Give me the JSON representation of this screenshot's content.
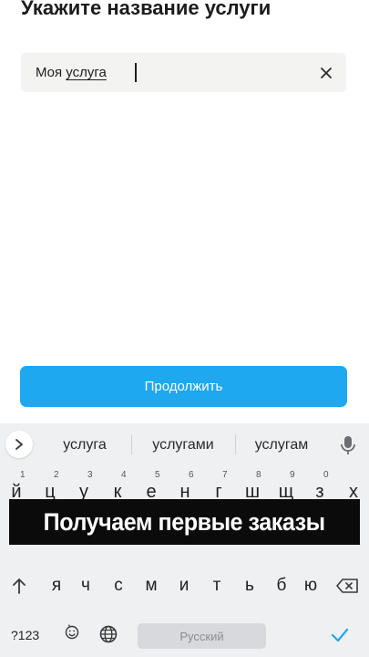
{
  "header": {
    "title": "Укажите название услуги"
  },
  "service_field": {
    "value_prefix": "Моя ",
    "value_word": "услуга"
  },
  "continue_button": {
    "label": "Продолжить"
  },
  "keyboard": {
    "suggestions": [
      "услуга",
      "услугами",
      "услугам"
    ],
    "row1": [
      {
        "key": "й",
        "hint": "1"
      },
      {
        "key": "ц",
        "hint": "2"
      },
      {
        "key": "у",
        "hint": "3"
      },
      {
        "key": "к",
        "hint": "4"
      },
      {
        "key": "е",
        "hint": "5"
      },
      {
        "key": "н",
        "hint": "6"
      },
      {
        "key": "г",
        "hint": "7"
      },
      {
        "key": "ш",
        "hint": "8"
      },
      {
        "key": "щ",
        "hint": "9"
      },
      {
        "key": "з",
        "hint": "0"
      },
      {
        "key": "х",
        "hint": ""
      }
    ],
    "row3": [
      "я",
      "ч",
      "с",
      "м",
      "и",
      "т",
      "ь",
      "б",
      "ю"
    ],
    "numbers_key": "?123",
    "emoji_key": ",",
    "space_label": "Русский"
  },
  "banner": {
    "text": "Получаем первые заказы"
  },
  "colors": {
    "accent": "#1ea8f0",
    "field_bg": "#f3f3f1",
    "keyboard_bg": "#eef0f2",
    "banner_bg": "#0b0b0b"
  },
  "icons": {
    "clear": "close-icon",
    "expand": "chevron-right-icon",
    "mic": "microphone-icon",
    "shift": "shift-arrow-icon",
    "backspace": "backspace-icon",
    "globe": "globe-icon",
    "enter": "checkmark-icon",
    "emoji": "emoji-icon"
  }
}
